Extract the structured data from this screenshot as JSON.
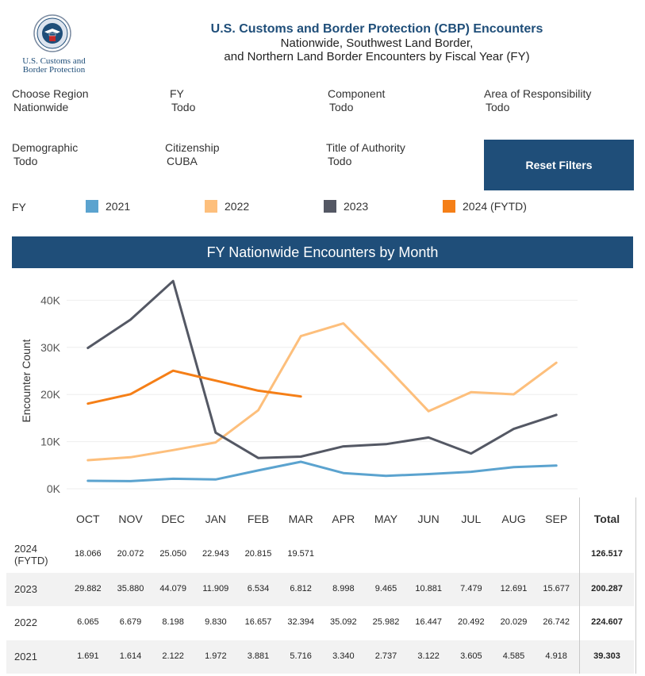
{
  "logo": {
    "line1": "U.S. Customs and",
    "line2": "Border Protection"
  },
  "header": {
    "title": "U.S. Customs and Border Protection (CBP) Encounters",
    "subtitle1": "Nationwide, Southwest Land Border,",
    "subtitle2": "and Northern Land Border Encounters by Fiscal Year (FY)"
  },
  "filters": [
    {
      "label": "Choose Region",
      "value": "Nationwide"
    },
    {
      "label": "FY",
      "value": "Todo"
    },
    {
      "label": "Component",
      "value": "Todo"
    },
    {
      "label": "Area of Responsibility",
      "value": "Todo"
    },
    {
      "label": "Demographic",
      "value": "Todo"
    },
    {
      "label": "Citizenship",
      "value": "CUBA"
    },
    {
      "label": "Title of Authority",
      "value": "Todo"
    }
  ],
  "reset_label": "Reset Filters",
  "legend": {
    "title": "FY",
    "items": [
      {
        "label": "2021",
        "color": "#5ba3cf"
      },
      {
        "label": "2022",
        "color": "#fdbf7c"
      },
      {
        "label": "2023",
        "color": "#545864"
      },
      {
        "label": "2024 (FYTD)",
        "color": "#f57f17"
      }
    ]
  },
  "banner": "FY Nationwide Encounters by Month",
  "chart_data": {
    "type": "line",
    "ylabel": "Encounter Count",
    "xlabel": "",
    "categories": [
      "OCT",
      "NOV",
      "DEC",
      "JAN",
      "FEB",
      "MAR",
      "APR",
      "MAY",
      "JUN",
      "JUL",
      "AUG",
      "SEP"
    ],
    "ylim": [
      0,
      45000
    ],
    "yticks": [
      0,
      10000,
      20000,
      30000,
      40000
    ],
    "ytick_labels": [
      "0K",
      "10K",
      "20K",
      "30K",
      "40K"
    ],
    "grid": "horizontal",
    "series": [
      {
        "name": "2021",
        "color": "#5ba3cf",
        "values": [
          1691,
          1614,
          2122,
          1972,
          3881,
          5716,
          3340,
          2737,
          3122,
          3605,
          4585,
          4918
        ]
      },
      {
        "name": "2022",
        "color": "#fdbf7c",
        "values": [
          6065,
          6679,
          8198,
          9830,
          16657,
          32394,
          35092,
          25982,
          16447,
          20492,
          20029,
          26742
        ]
      },
      {
        "name": "2023",
        "color": "#545864",
        "values": [
          29882,
          35880,
          44079,
          11909,
          6534,
          6812,
          8998,
          9465,
          10881,
          7479,
          12691,
          15677
        ]
      },
      {
        "name": "2024 (FYTD)",
        "color": "#f57f17",
        "values": [
          18066,
          20072,
          25050,
          22943,
          20815,
          19571
        ]
      }
    ]
  },
  "table": {
    "months": [
      "OCT",
      "NOV",
      "DEC",
      "JAN",
      "FEB",
      "MAR",
      "APR",
      "MAY",
      "JUN",
      "JUL",
      "AUG",
      "SEP"
    ],
    "total_header": "Total",
    "rows": [
      {
        "label": [
          "2024",
          "(FYTD)"
        ],
        "values": [
          "18.066",
          "20.072",
          "25.050",
          "22.943",
          "20.815",
          "19.571",
          "",
          "",
          "",
          "",
          "",
          ""
        ],
        "total": "126.517"
      },
      {
        "label": [
          "2023"
        ],
        "values": [
          "29.882",
          "35.880",
          "44.079",
          "11.909",
          "6.534",
          "6.812",
          "8.998",
          "9.465",
          "10.881",
          "7.479",
          "12.691",
          "15.677"
        ],
        "total": "200.287"
      },
      {
        "label": [
          "2022"
        ],
        "values": [
          "6.065",
          "6.679",
          "8.198",
          "9.830",
          "16.657",
          "32.394",
          "35.092",
          "25.982",
          "16.447",
          "20.492",
          "20.029",
          "26.742"
        ],
        "total": "224.607"
      },
      {
        "label": [
          "2021"
        ],
        "values": [
          "1.691",
          "1.614",
          "2.122",
          "1.972",
          "3.881",
          "5.716",
          "3.340",
          "2.737",
          "3.122",
          "3.605",
          "4.585",
          "4.918"
        ],
        "total": "39.303"
      }
    ]
  }
}
